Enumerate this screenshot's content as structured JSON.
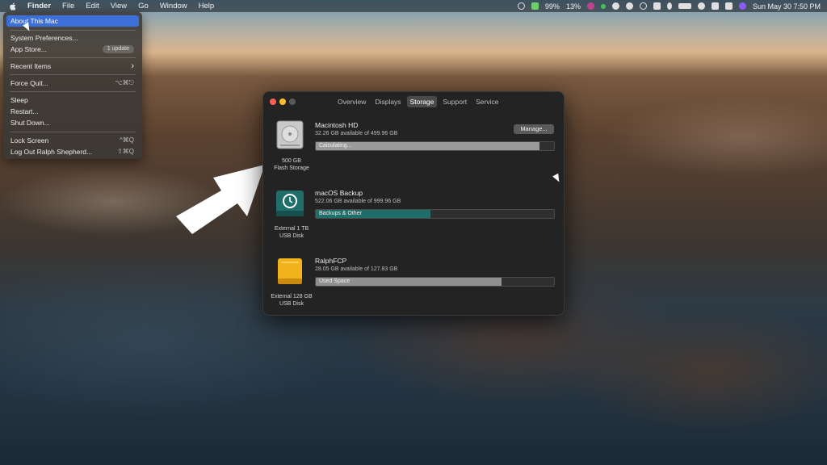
{
  "menubar": {
    "items": [
      "Finder",
      "File",
      "Edit",
      "View",
      "Go",
      "Window",
      "Help"
    ],
    "status": {
      "battery_a": "99%",
      "battery_b": "13%",
      "datetime": "Sun May 30  7:50 PM"
    }
  },
  "apple_menu": {
    "about": "About This Mac",
    "sysprefs": "System Preferences...",
    "appstore": "App Store...",
    "appstore_badge": "1 update",
    "recent": "Recent Items",
    "recent_arrow": "›",
    "forcequit": "Force Quit...",
    "forcequit_shortcut": "⌥⌘⎋",
    "sleep": "Sleep",
    "restart": "Restart...",
    "shutdown": "Shut Down...",
    "lock": "Lock Screen",
    "lock_shortcut": "^⌘Q",
    "logout": "Log Out Ralph Shepherd...",
    "logout_shortcut": "⇧⌘Q"
  },
  "window": {
    "tabs": [
      "Overview",
      "Displays",
      "Storage",
      "Support",
      "Service"
    ],
    "active_tab": "Storage",
    "manage_label": "Manage...",
    "disks": [
      {
        "name": "Macintosh HD",
        "available": "32.26 GB available of 499.96 GB",
        "bar_label": "Calculating...",
        "fill": 0.94,
        "fill_color": "#9a9a9a",
        "caption1": "500 GB",
        "caption2": "Flash Storage"
      },
      {
        "name": "macOS Backup",
        "available": "522.06 GB available of 999.96 GB",
        "bar_label": "Backups & Other",
        "fill": 0.48,
        "fill_color": "#1f6e6a",
        "caption1": "External 1 TB",
        "caption2": "USB Disk"
      },
      {
        "name": "RalphFCP",
        "available": "28.05 GB available of 127.83 GB",
        "bar_label": "Used Space",
        "fill": 0.78,
        "fill_color": "#8f8f8f",
        "caption1": "External 128 GB",
        "caption2": "USB Disk"
      }
    ]
  },
  "colors": {
    "highlight": "#3d6fd9",
    "window_bg": "#232323",
    "backup_teal": "#1f6e6a",
    "usb_yellow": "#f2b21c"
  }
}
